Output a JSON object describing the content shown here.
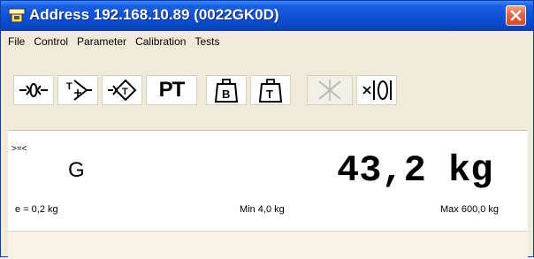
{
  "window": {
    "title": "Address 192.168.10.89 (0022GK0D)",
    "title_color": "#0f4fd4",
    "close_color": "#d2472a"
  },
  "menu": [
    {
      "label": "File"
    },
    {
      "label": "Control"
    },
    {
      "label": "Parameter"
    },
    {
      "label": "Calibration"
    },
    {
      "label": "Tests"
    }
  ],
  "toolbar": {
    "zero_icon": "zero-icon",
    "tare_icon": "tare-icon",
    "preset_tare_icon": "preset-tare-icon",
    "pt_label": "PT",
    "gross_weight_icon": "gross-weight-icon",
    "tare_weight_icon": "tare-weight-icon",
    "clear_icon": "clear-icon",
    "clear_enabled": false,
    "multiply_zero_label": "×|0|"
  },
  "display": {
    "stable_indicator": ">=<",
    "mode": "G",
    "weight": "43,2 kg",
    "e": "e = 0,2 kg",
    "min": "Min 4,0 kg",
    "max": "Max 600,0 kg"
  }
}
